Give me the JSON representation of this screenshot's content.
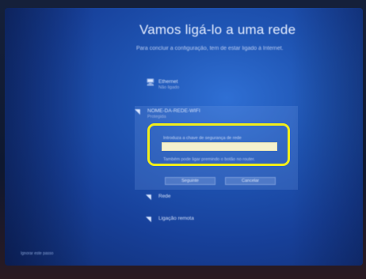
{
  "page": {
    "title": "Vamos ligá-lo a uma rede",
    "subtitle": "Para concluir a configuração, tem de estar ligado à Internet."
  },
  "networks": [
    {
      "name": "Ethernet",
      "status": "Não ligado",
      "icon": "ethernet-icon"
    },
    {
      "name": "NOME-DA-REDE-WIFI",
      "status": "Protegida",
      "icon": "wifi-icon"
    },
    {
      "name": "Rede",
      "status": "",
      "icon": "wifi-icon"
    },
    {
      "name": "Ligação remota",
      "status": "",
      "icon": "wifi-icon"
    }
  ],
  "wifi_panel": {
    "field_label": "Introduza a chave de segurança de rede",
    "password_value": "",
    "hint": "Também pode ligar premindo o botão no router.",
    "next_label": "Seguinte",
    "cancel_label": "Cancelar"
  },
  "footer": {
    "skip_label": "Ignorar este passo"
  },
  "colors": {
    "screen_blue": "#1f55b4",
    "highlight": "#f2ee1a",
    "input_fill": "#f4f1ce"
  }
}
